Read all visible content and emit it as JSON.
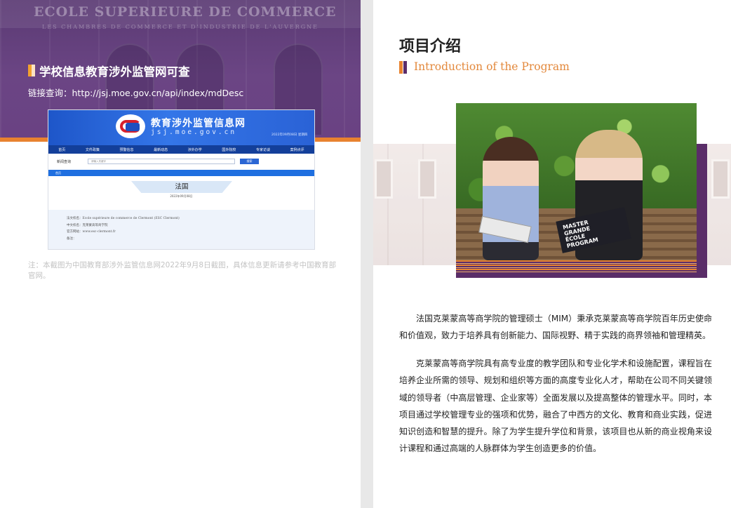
{
  "left_page": {
    "hero": {
      "engraving": "ECOLE SUPERIEURE DE COMMERCE",
      "engraving_sub": "LES CHAMBRES DE COMMERCE ET D'INDUSTRIE DE L'AUVERGNE",
      "title": "学校信息教育涉外监管网可查",
      "link": "链接查询：http://jsj.moe.gov.cn/api/index/mdDesc"
    },
    "screenshot": {
      "site_title": "教育涉外监管信息网",
      "site_url": "jsj.moe.gov.cn",
      "date": "2022年09月08日 星期四",
      "nav": [
        "首页",
        "文件政策",
        "预警信息",
        "最新动态",
        "涉外办学",
        "国外院校",
        "专家访谈",
        "案例点评"
      ],
      "search_label": "新闻查询",
      "search_placeholder": "请输入关键字",
      "search_button": "搜索",
      "breadcrumb": "首页",
      "country": "法国",
      "country_date": "2022年09月08日",
      "info": [
        "法文校名：Ecole supérieure de commerce de Clermont (ESC Clermont)",
        "中文校名：克莱蒙高等商学院",
        "官方网站：www.esc-clermont.fr",
        "备注："
      ]
    },
    "note": "注：本截图为中国教育部涉外监管信息网2022年9月8日截图，具体信息更新请参考中国教育部官网。"
  },
  "right_page": {
    "title": "项目介绍",
    "subtitle": "Introduction of the Program",
    "photo": {
      "magazine_text": "MASTER\nGRANDE\nÉCOLE\nPROGRAM"
    },
    "paragraphs": [
      "法国克莱蒙高等商学院的管理硕士（MIM）秉承克莱蒙高等商学院百年历史使命和价值观，致力于培养具有创新能力、国际视野、精于实践的商界领袖和管理精英。",
      "克莱蒙高等商学院具有高专业度的教学团队和专业化学术和设施配置，课程旨在培养企业所需的领导、规划和组织等方面的高度专业化人才，帮助在公司不同关键领域的领导者（中高层管理、企业家等）全面发展以及提高整体的管理水平。同时，本项目通过学校管理专业的强项和优势，融合了中西方的文化、教育和商业实践，促进知识创造和智慧的提升。除了为学生提升学位和背景，该项目也从新的商业视角来设计课程和通过高端的人脉群体为学生创造更多的价值。"
    ]
  },
  "colors": {
    "purple": "#5a2d68",
    "orange": "#e8822f",
    "site_blue": "#2a62d6"
  }
}
